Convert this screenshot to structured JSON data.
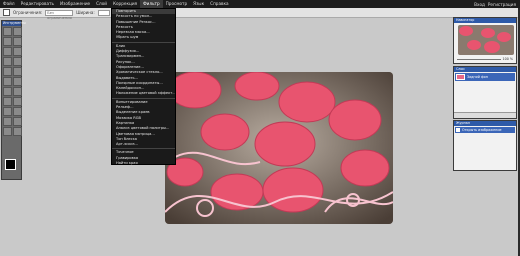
{
  "menubar": {
    "items": [
      "Файл",
      "Редактировать",
      "Изображение",
      "Слой",
      "Коррекция",
      "Фильтр",
      "Просмотр",
      "Язык",
      "Справка"
    ],
    "active_index": 5,
    "login": "Вход",
    "register": "Регистрация"
  },
  "options": {
    "constraint_label": "Ограничения:",
    "constraint_value": "Без ограничения",
    "width_label": "Ширина:",
    "height_label": "Высота:"
  },
  "toolbox": {
    "title": "Инструменты"
  },
  "filter_menu": {
    "groups": [
      [
        "Повторить",
        "Резкость по умол...",
        "Повышение Резкос...",
        "Резкость",
        "Нерезкая маска...",
        "Убрать шум"
      ],
      [
        "Блик",
        "Диффузия...",
        "Трансвирмен...",
        "Рисунок...",
        "Оформление...",
        "Хроматическое стекло...",
        "Выдавить...",
        "Полярные координаты...",
        "Калейдоскоп...",
        "Наложение цветовой эффект..."
      ],
      [
        "Виньетирование",
        "Рельеф...",
        "Выделение краев",
        "Мозаика RGB",
        "Картинка",
        "Анализ цветовой палитры...",
        "Цветовая матрица...",
        "Тон блеска",
        "Арт-эскиз..."
      ],
      [
        "Точечное",
        "Гравировка",
        "Найти края"
      ]
    ]
  },
  "panels": {
    "navigator": {
      "title": "Навигатор",
      "zoom": "100 %"
    },
    "layers": {
      "title": "Слои",
      "layer_name": "Задний фон"
    },
    "history": {
      "title": "Журнал",
      "entry": "Открыть изображение"
    }
  },
  "colors": {
    "menubar": "#1c1c1c",
    "panel_header": "#2e5aa8",
    "workspace": "#c9c9c9",
    "cookie_pink": "#e8546f"
  }
}
